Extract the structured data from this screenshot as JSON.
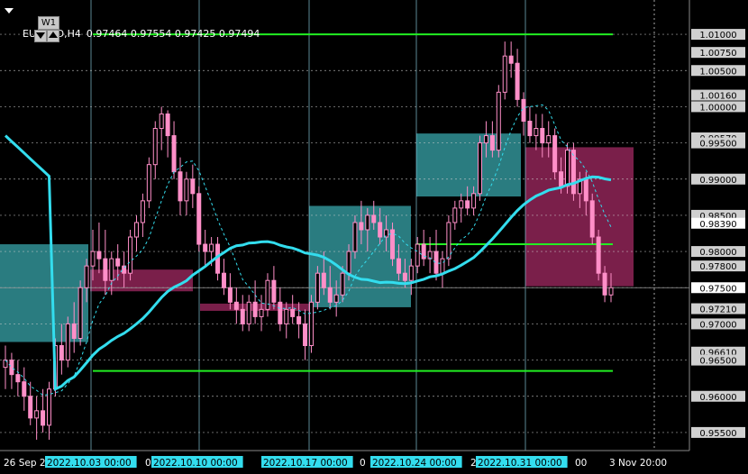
{
  "header": {
    "symbol": "EURUSD,H4",
    "ohlc": "0.97464 0.97554 0.97425 0.97494",
    "timeframe_button": "W1"
  },
  "colors": {
    "background": "#000000",
    "bull_candle": "#ff8fc8",
    "bear_candle": "#ff8fc8",
    "ma_line": "#33ddee",
    "dashed_ma": "#33ddee",
    "support_resistance": "#22ee22",
    "bull_zone": "#2a7c80",
    "bear_zone": "#7a1f4a",
    "grid": "#8fd8ea",
    "price_label_bg": "#d0d0d0"
  },
  "chart_data": {
    "type": "candlestick",
    "ylim": [
      0.9525,
      1.0125
    ],
    "price_axis_labels": [
      "1.01000",
      "1.00750",
      "1.00500",
      "1.00160",
      "1.00000",
      "0.99570",
      "0.99500",
      "0.99000",
      "0.98500",
      "0.98390",
      "0.98000",
      "0.97800",
      "0.97500",
      "0.97210",
      "0.97000",
      "0.96610",
      "0.96500",
      "0.96000",
      "0.95500"
    ],
    "highlighted_labels": [
      "0.98390",
      "0.97500"
    ],
    "time_axis_labels": [
      "26 Sep 2",
      "2022.10.03 00:00",
      "0",
      "2022.10.10 00:00",
      "2022.10.17 00:00",
      "0",
      "2022.10.24 00:00",
      "2",
      "2022.10.31 00:00",
      "00",
      "3 Nov 20:00"
    ],
    "time_labels_highlighted": [
      "2022.10.03 00:00",
      "2022.10.10 00:00",
      "2022.10.17 00:00",
      "2022.10.24 00:00",
      "2022.10.31 00:00"
    ],
    "horizontal_levels": [
      1.01,
      0.981,
      0.9635
    ],
    "current_price": 0.975,
    "grid": true,
    "candles": [
      [
        0.964,
        0.967,
        0.961,
        0.965
      ],
      [
        0.965,
        0.966,
        0.961,
        0.963
      ],
      [
        0.963,
        0.965,
        0.96,
        0.962
      ],
      [
        0.962,
        0.964,
        0.958,
        0.96
      ],
      [
        0.96,
        0.962,
        0.956,
        0.957
      ],
      [
        0.957,
        0.96,
        0.954,
        0.958
      ],
      [
        0.958,
        0.961,
        0.955,
        0.956
      ],
      [
        0.956,
        0.962,
        0.954,
        0.961
      ],
      [
        0.961,
        0.968,
        0.96,
        0.967
      ],
      [
        0.967,
        0.97,
        0.963,
        0.965
      ],
      [
        0.965,
        0.971,
        0.964,
        0.97
      ],
      [
        0.97,
        0.973,
        0.966,
        0.968
      ],
      [
        0.968,
        0.976,
        0.967,
        0.975
      ],
      [
        0.975,
        0.979,
        0.973,
        0.978
      ],
      [
        0.978,
        0.983,
        0.976,
        0.98
      ],
      [
        0.98,
        0.984,
        0.977,
        0.979
      ],
      [
        0.979,
        0.983,
        0.974,
        0.976
      ],
      [
        0.976,
        0.98,
        0.974,
        0.979
      ],
      [
        0.979,
        0.981,
        0.976,
        0.978
      ],
      [
        0.978,
        0.98,
        0.975,
        0.977
      ],
      [
        0.977,
        0.983,
        0.976,
        0.982
      ],
      [
        0.982,
        0.985,
        0.98,
        0.984
      ],
      [
        0.984,
        0.988,
        0.982,
        0.987
      ],
      [
        0.987,
        0.993,
        0.986,
        0.992
      ],
      [
        0.992,
        0.998,
        0.99,
        0.997
      ],
      [
        0.997,
        1.0,
        0.994,
        0.999
      ],
      [
        0.999,
        0.9995,
        0.993,
        0.996
      ],
      [
        0.996,
        0.998,
        0.99,
        0.991
      ],
      [
        0.991,
        0.993,
        0.985,
        0.987
      ],
      [
        0.987,
        0.991,
        0.985,
        0.99
      ],
      [
        0.99,
        0.992,
        0.986,
        0.988
      ],
      [
        0.988,
        0.989,
        0.98,
        0.981
      ],
      [
        0.981,
        0.983,
        0.978,
        0.98
      ],
      [
        0.98,
        0.982,
        0.978,
        0.981
      ],
      [
        0.981,
        0.982,
        0.976,
        0.977
      ],
      [
        0.977,
        0.979,
        0.974,
        0.975
      ],
      [
        0.975,
        0.977,
        0.972,
        0.973
      ],
      [
        0.973,
        0.975,
        0.97,
        0.972
      ],
      [
        0.972,
        0.974,
        0.969,
        0.97
      ],
      [
        0.97,
        0.974,
        0.969,
        0.973
      ],
      [
        0.973,
        0.976,
        0.97,
        0.971
      ],
      [
        0.971,
        0.974,
        0.969,
        0.972
      ],
      [
        0.972,
        0.977,
        0.971,
        0.976
      ],
      [
        0.976,
        0.978,
        0.972,
        0.973
      ],
      [
        0.973,
        0.975,
        0.969,
        0.97
      ],
      [
        0.97,
        0.973,
        0.968,
        0.972
      ],
      [
        0.972,
        0.974,
        0.97,
        0.971
      ],
      [
        0.971,
        0.973,
        0.968,
        0.97
      ],
      [
        0.97,
        0.972,
        0.965,
        0.967
      ],
      [
        0.967,
        0.974,
        0.966,
        0.973
      ],
      [
        0.973,
        0.978,
        0.972,
        0.977
      ],
      [
        0.977,
        0.98,
        0.974,
        0.975
      ],
      [
        0.975,
        0.978,
        0.972,
        0.973
      ],
      [
        0.973,
        0.976,
        0.971,
        0.974
      ],
      [
        0.974,
        0.978,
        0.973,
        0.977
      ],
      [
        0.977,
        0.981,
        0.976,
        0.98
      ],
      [
        0.98,
        0.985,
        0.979,
        0.984
      ],
      [
        0.984,
        0.987,
        0.981,
        0.983
      ],
      [
        0.983,
        0.986,
        0.98,
        0.985
      ],
      [
        0.985,
        0.987,
        0.983,
        0.984
      ],
      [
        0.984,
        0.986,
        0.981,
        0.982
      ],
      [
        0.982,
        0.985,
        0.98,
        0.983
      ],
      [
        0.983,
        0.984,
        0.978,
        0.979
      ],
      [
        0.979,
        0.981,
        0.976,
        0.977
      ],
      [
        0.977,
        0.979,
        0.975,
        0.976
      ],
      [
        0.976,
        0.979,
        0.974,
        0.978
      ],
      [
        0.978,
        0.982,
        0.977,
        0.981
      ],
      [
        0.981,
        0.983,
        0.978,
        0.979
      ],
      [
        0.979,
        0.982,
        0.977,
        0.98
      ],
      [
        0.98,
        0.983,
        0.976,
        0.977
      ],
      [
        0.977,
        0.98,
        0.975,
        0.979
      ],
      [
        0.979,
        0.985,
        0.978,
        0.984
      ],
      [
        0.984,
        0.987,
        0.983,
        0.986
      ],
      [
        0.986,
        0.988,
        0.984,
        0.987
      ],
      [
        0.987,
        0.989,
        0.985,
        0.986
      ],
      [
        0.986,
        0.989,
        0.985,
        0.988
      ],
      [
        0.988,
        0.996,
        0.987,
        0.995
      ],
      [
        0.995,
        0.998,
        0.993,
        0.996
      ],
      [
        0.996,
        0.998,
        0.993,
        0.994
      ],
      [
        0.994,
        1.003,
        0.993,
        1.002
      ],
      [
        1.002,
        1.009,
        1.001,
        1.007
      ],
      [
        1.007,
        1.009,
        1.004,
        1.006
      ],
      [
        1.006,
        1.008,
        1.0,
        1.001
      ],
      [
        1.001,
        1.002,
        0.996,
        0.998
      ],
      [
        0.998,
        1.0,
        0.995,
        0.996
      ],
      [
        0.996,
        0.999,
        0.994,
        0.997
      ],
      [
        0.997,
        0.999,
        0.993,
        0.995
      ],
      [
        0.995,
        0.998,
        0.993,
        0.996
      ],
      [
        0.996,
        0.997,
        0.99,
        0.991
      ],
      [
        0.991,
        0.993,
        0.988,
        0.989
      ],
      [
        0.989,
        0.995,
        0.988,
        0.994
      ],
      [
        0.994,
        0.995,
        0.987,
        0.988
      ],
      [
        0.988,
        0.991,
        0.986,
        0.99
      ],
      [
        0.99,
        0.991,
        0.985,
        0.987
      ],
      [
        0.987,
        0.988,
        0.981,
        0.982
      ],
      [
        0.982,
        0.983,
        0.976,
        0.977
      ],
      [
        0.977,
        0.978,
        0.973,
        0.974
      ],
      [
        0.974,
        0.977,
        0.973,
        0.975
      ]
    ]
  }
}
